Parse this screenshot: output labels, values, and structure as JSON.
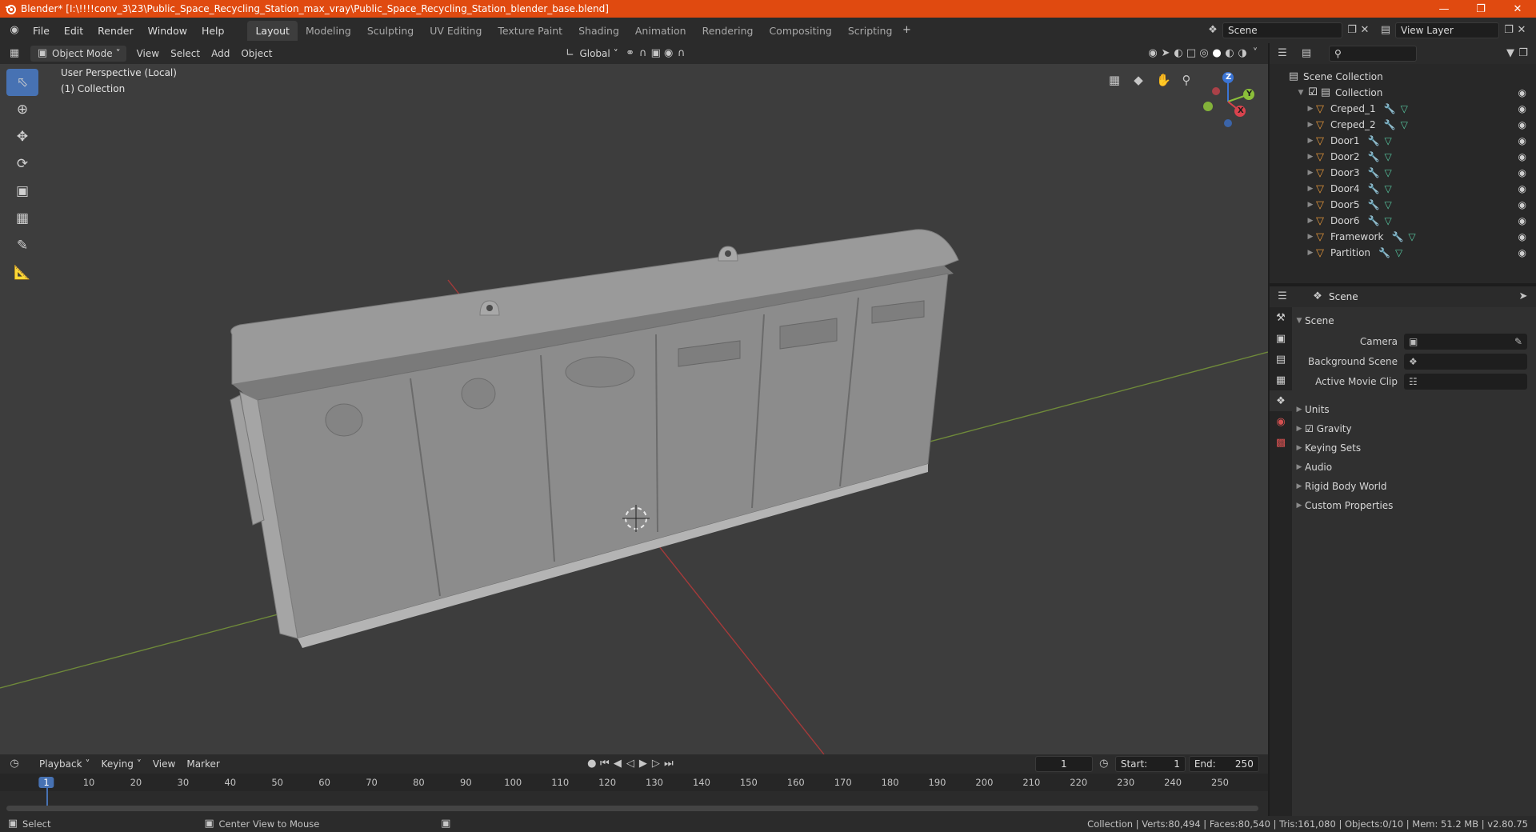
{
  "window": {
    "title": "Blender* [I:\\!!!!conv_3\\23\\Public_Space_Recycling_Station_max_vray\\Public_Space_Recycling_Station_blender_base.blend]"
  },
  "menu": [
    "File",
    "Edit",
    "Render",
    "Window",
    "Help"
  ],
  "workspaces": [
    "Layout",
    "Modeling",
    "Sculpting",
    "UV Editing",
    "Texture Paint",
    "Shading",
    "Animation",
    "Rendering",
    "Compositing",
    "Scripting"
  ],
  "active_workspace": "Layout",
  "scene_field": "Scene",
  "view_layer_field": "View Layer",
  "viewport_header": {
    "mode": "Object Mode",
    "menus": [
      "View",
      "Select",
      "Add",
      "Object"
    ],
    "transform_orientation": "Global"
  },
  "viewport": {
    "perspective_label": "User Perspective (Local)",
    "collection_label": "(1) Collection",
    "gizmo": {
      "x": "X",
      "y": "Y",
      "z": "Z"
    }
  },
  "outliner": {
    "root": "Scene Collection",
    "collection": "Collection",
    "items": [
      "Creped_1",
      "Creped_2",
      "Door1",
      "Door2",
      "Door3",
      "Door4",
      "Door5",
      "Door6",
      "Framework",
      "Partition"
    ]
  },
  "properties": {
    "header": "Scene",
    "panel_title": "Scene",
    "fields": [
      {
        "label": "Camera"
      },
      {
        "label": "Background Scene"
      },
      {
        "label": "Active Movie Clip"
      }
    ],
    "sections": [
      "Units",
      "Gravity",
      "Keying Sets",
      "Audio",
      "Rigid Body World",
      "Custom Properties"
    ]
  },
  "timeline": {
    "menus": [
      "Playback",
      "Keying",
      "View",
      "Marker"
    ],
    "current_frame": "1",
    "start_label": "Start:",
    "start": "1",
    "end_label": "End:",
    "end": "250",
    "ticks": [
      "1",
      "10",
      "20",
      "30",
      "40",
      "50",
      "60",
      "70",
      "80",
      "90",
      "100",
      "110",
      "120",
      "130",
      "140",
      "150",
      "160",
      "170",
      "180",
      "190",
      "200",
      "210",
      "220",
      "230",
      "240",
      "250"
    ]
  },
  "status_bar": {
    "select": "Select",
    "center_view": "Center View to Mouse",
    "stats": "Collection | Verts:80,494 | Faces:80,540 | Tris:161,080 | Objects:0/10 | Mem: 51.2 MB | v2.80.75"
  }
}
